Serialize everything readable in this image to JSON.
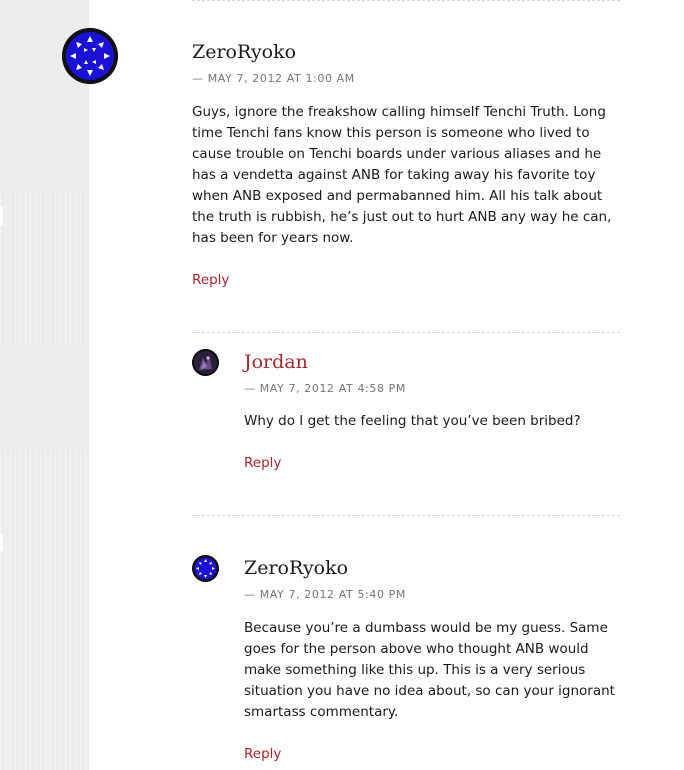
{
  "comments": [
    {
      "author": "ZeroRyoko",
      "meta": "— MAY 7, 2012 AT 1:00 AM",
      "body": "Guys, ignore the freakshow calling himself Tenchi Truth. Long time Tenchi fans know this person is someone who lived to cause trouble on Tenchi boards under various aliases and he has a vendetta against ANB for taking away his favorite toy when ANB exposed and permabanned him. All his talk about the truth is rubbish, he’s just out to hurt ANB any way he can, has been for years now.",
      "reply": "Reply",
      "avatar_icon": "blue-pattern-avatar"
    },
    {
      "author": "Jordan",
      "meta": "— MAY 7, 2012 AT 4:58 PM",
      "body": "Why do I get the feeling that you’ve been bribed?",
      "reply": "Reply",
      "avatar_icon": "dark-figure-avatar"
    },
    {
      "author": "ZeroRyoko",
      "meta": "— MAY 7, 2012 AT 5:40 PM",
      "body": "Because you’re a dumbass would be my guess. Same goes for the person above who thought ANB would make something like this up. This is a very serious situation you have no idea about, so can your ignorant smartass commentary.",
      "reply": "Reply",
      "avatar_icon": "blue-pattern-avatar"
    }
  ],
  "colors": {
    "link": "#a8262b",
    "text": "#1a1a1a",
    "meta": "#757575",
    "sidebar": "#ececec",
    "avatar_blue": "#1a10d8"
  }
}
